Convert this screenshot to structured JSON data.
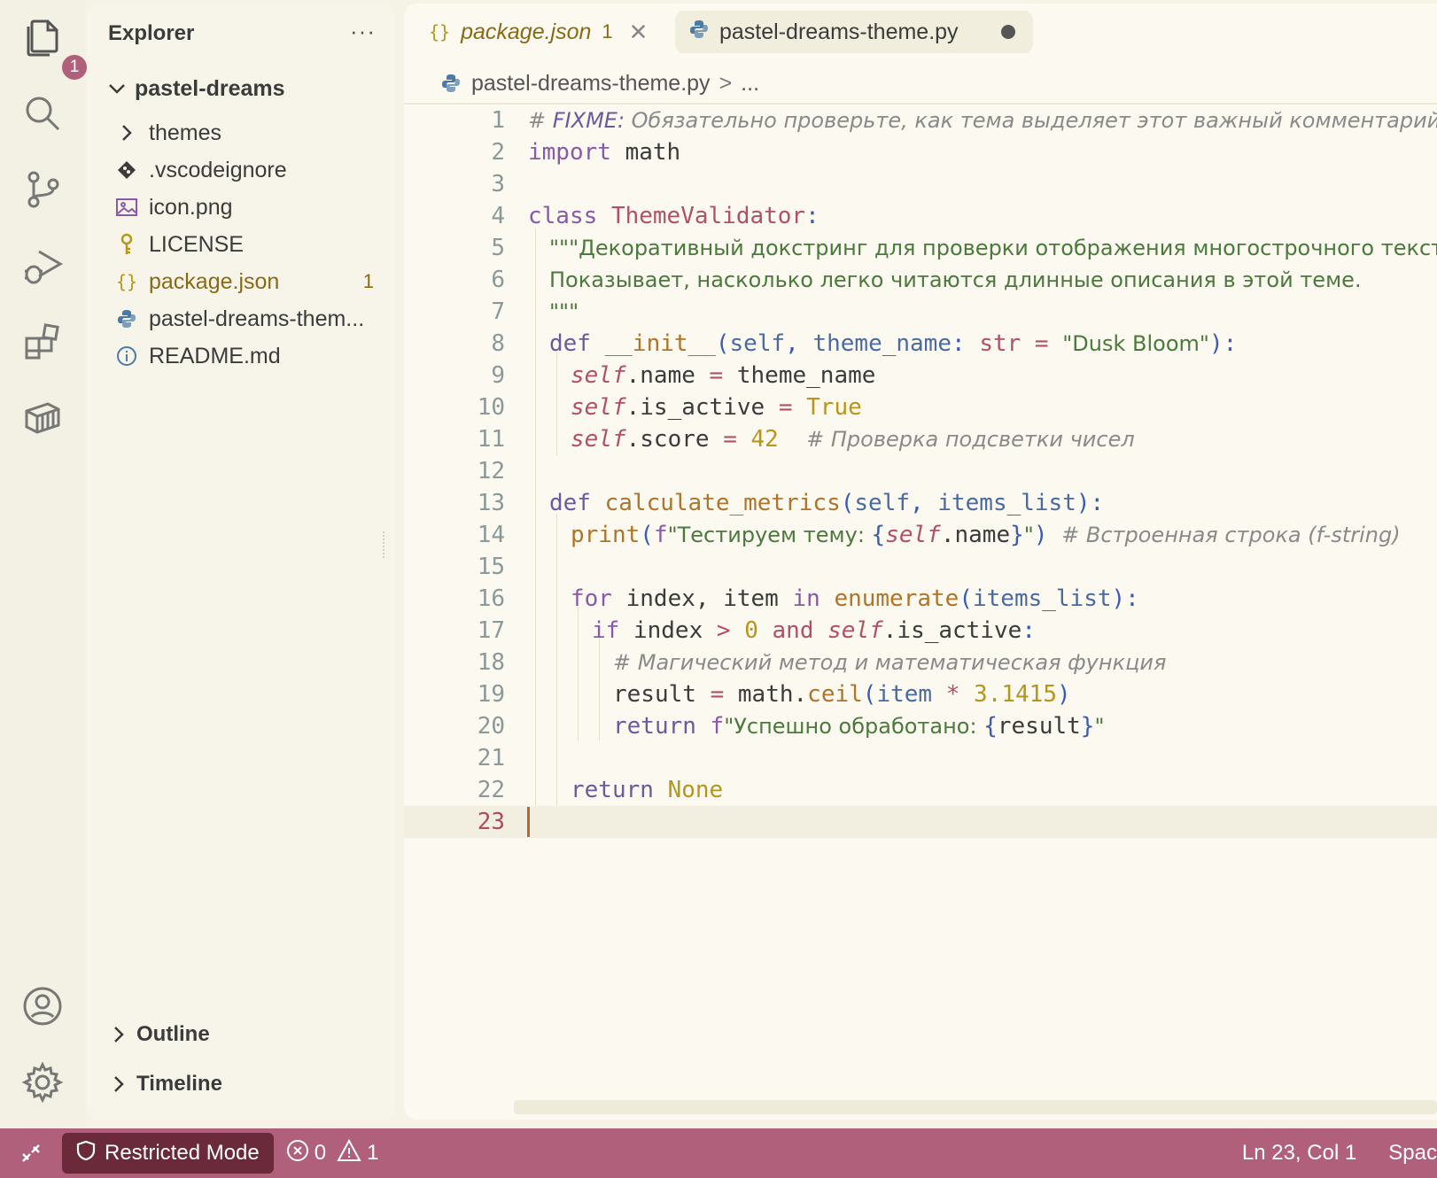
{
  "colors": {
    "accent": "#b0607a",
    "restricted_bg": "#6a2a3a",
    "background": "#f5f3e6"
  },
  "activity_bar": {
    "items": [
      {
        "icon": "files-icon",
        "badge": "1"
      },
      {
        "icon": "search-icon"
      },
      {
        "icon": "source-control-icon"
      },
      {
        "icon": "run-debug-icon"
      },
      {
        "icon": "extensions-icon"
      },
      {
        "icon": "remote-explorer-icon"
      }
    ],
    "bottom": [
      {
        "icon": "account-icon"
      },
      {
        "icon": "settings-gear-icon"
      }
    ]
  },
  "sidebar": {
    "title": "Explorer",
    "more": "···",
    "folder": "pastel-dreams",
    "items": [
      {
        "label": "themes",
        "icon": "chevron-right-icon"
      },
      {
        "label": ".vscodeignore",
        "icon": "git-icon"
      },
      {
        "label": "icon.png",
        "icon": "image-icon"
      },
      {
        "label": "LICENSE",
        "icon": "key-icon"
      },
      {
        "label": "package.json",
        "icon": "json-icon",
        "count": "1"
      },
      {
        "label": "pastel-dreams-them...",
        "icon": "python-icon"
      },
      {
        "label": "README.md",
        "icon": "info-icon"
      }
    ],
    "outline": "Outline",
    "timeline": "Timeline"
  },
  "editor": {
    "tabs": [
      {
        "label": "package.json",
        "count": "1",
        "close": "✕"
      },
      {
        "label": "pastel-dreams-theme.py"
      }
    ],
    "breadcrumb": {
      "file": "pastel-dreams-theme.py",
      "sep": ">",
      "rest": "..."
    },
    "current_line": 23
  },
  "status_bar": {
    "restricted": "Restricted Mode",
    "errors": "0",
    "warnings": "1",
    "position": "Ln 23, Col 1",
    "spaces": "Spac"
  }
}
